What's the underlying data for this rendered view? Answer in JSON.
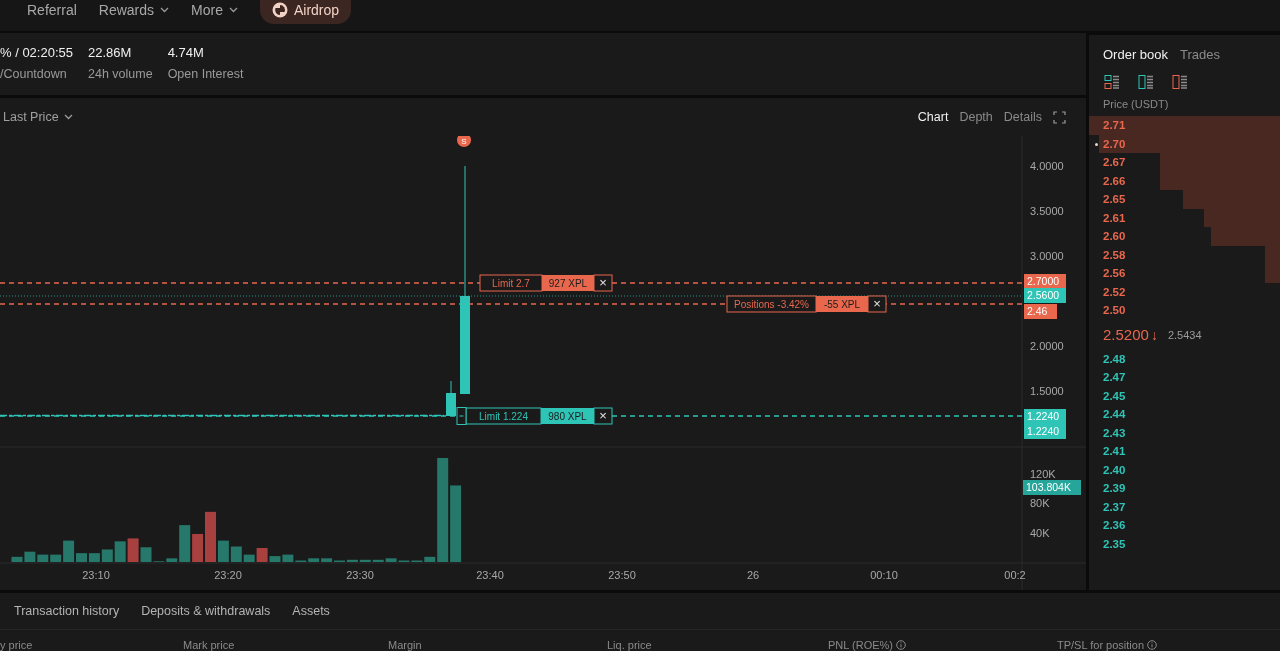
{
  "top_nav": {
    "items": [
      {
        "label": "Referral",
        "dropdown": false
      },
      {
        "label": "Rewards",
        "dropdown": true
      },
      {
        "label": "More",
        "dropdown": true
      }
    ],
    "airdrop": {
      "label": "Airdrop"
    }
  },
  "stats": [
    {
      "value": "% / 02:20:55",
      "label": "/Countdown"
    },
    {
      "value": "22.86M",
      "label": "24h volume"
    },
    {
      "value": "4.74M",
      "label": "Open Interest"
    }
  ],
  "chart_toolbar": {
    "price_type": "Last Price",
    "views": [
      {
        "label": "Chart",
        "selected": true
      },
      {
        "label": "Depth",
        "selected": false
      },
      {
        "label": "Details",
        "selected": false
      }
    ]
  },
  "price_chart": {
    "price_ticks": [
      "4.0000",
      "3.5000",
      "3.0000",
      "2.0000",
      "1.5000"
    ],
    "time_labels": [
      "23:10",
      "23:20",
      "23:30",
      "23:40",
      "23:50",
      "26",
      "00:10",
      "00:2"
    ],
    "marker": "S",
    "orders": [
      {
        "label": "Limit 2.7",
        "quantity": "927 XPL",
        "close": "×",
        "color": "#e8674d",
        "handle": false
      },
      {
        "label": "Positions -3.42%",
        "quantity": "-55 XPL",
        "close": "×",
        "color": "#e8674d",
        "handle": false
      },
      {
        "label": "Limit 1.224",
        "quantity": "980 XPL",
        "close": "×",
        "color": "#2ec4b6",
        "handle": true
      }
    ],
    "price_tags": [
      {
        "text": "2.7000",
        "color": "#e8674d"
      },
      {
        "text": "2.5600",
        "color": "#2ec4b6"
      },
      {
        "text": "2.46",
        "color": "#e8674d"
      },
      {
        "text": "1.2240",
        "color": "#2ec4b6"
      },
      {
        "text": "1.2240",
        "color": "#2ec4b6"
      }
    ]
  },
  "volume": {
    "ticks": [
      "120K",
      "80K",
      "40K"
    ],
    "current_tag": "103.804K"
  },
  "order_book": {
    "tabs": [
      {
        "label": "Order book",
        "selected": true
      },
      {
        "label": "Trades",
        "selected": false
      }
    ],
    "layouts": [
      {
        "kind": "both"
      },
      {
        "kind": "bids"
      },
      {
        "kind": "asks"
      }
    ],
    "price_header": "Price (USDT)",
    "asks": [
      {
        "price": "2.71",
        "marked": false
      },
      {
        "price": "2.70",
        "marked": true
      },
      {
        "price": "2.67",
        "marked": false
      },
      {
        "price": "2.66",
        "marked": false
      },
      {
        "price": "2.65",
        "marked": false
      },
      {
        "price": "2.61",
        "marked": false
      },
      {
        "price": "2.60",
        "marked": false
      },
      {
        "price": "2.58",
        "marked": false
      },
      {
        "price": "2.56",
        "marked": false
      },
      {
        "price": "2.52",
        "marked": false
      },
      {
        "price": "2.50",
        "marked": false
      }
    ],
    "last_price": "2.5200",
    "direction": "↓",
    "mark_price": "2.5434",
    "bids": [
      {
        "price": "2.48"
      },
      {
        "price": "2.47"
      },
      {
        "price": "2.45"
      },
      {
        "price": "2.44"
      },
      {
        "price": "2.43"
      },
      {
        "price": "2.41"
      },
      {
        "price": "2.40"
      },
      {
        "price": "2.39"
      },
      {
        "price": "2.37"
      },
      {
        "price": "2.36"
      },
      {
        "price": "2.35"
      }
    ]
  },
  "bottom_tabs": [
    {
      "label": "Transaction history"
    },
    {
      "label": "Deposits & withdrawals"
    },
    {
      "label": "Assets"
    }
  ],
  "columns": [
    {
      "label": "y price",
      "info": false
    },
    {
      "label": "Mark price",
      "info": false
    },
    {
      "label": "Margin",
      "info": false
    },
    {
      "label": "Liq. price",
      "info": false
    },
    {
      "label": "PNL (ROE%)",
      "info": true
    },
    {
      "label": "TP/SL for position",
      "info": true
    }
  ]
}
